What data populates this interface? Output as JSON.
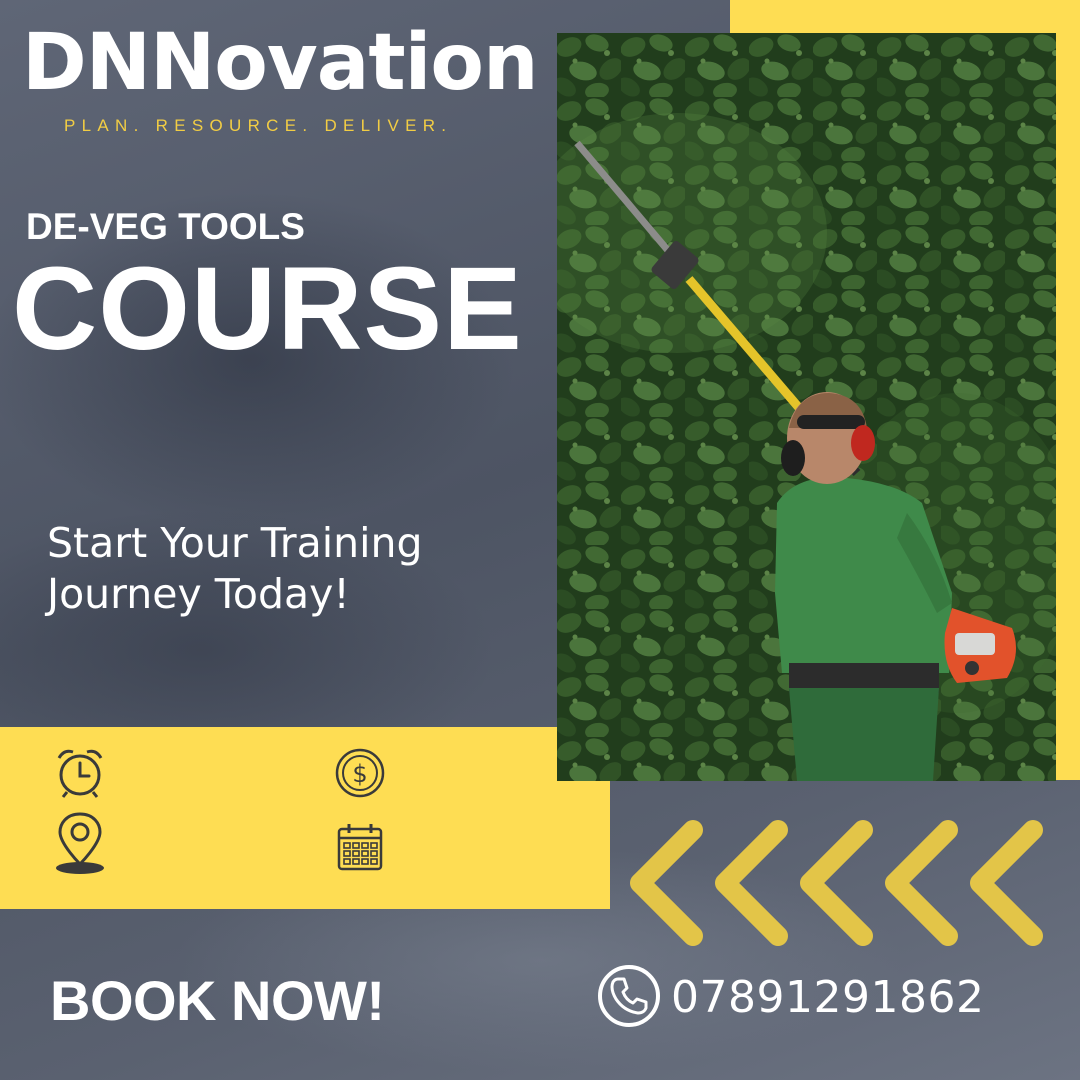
{
  "brand": {
    "name": "DNNovation",
    "tagline": "PLAN. RESOURCE. DELIVER."
  },
  "course": {
    "subtitle": "DE-VEG TOOLS",
    "title": "COURSE"
  },
  "promo": {
    "tagline_line1": "Start Your Training",
    "tagline_line2": "Journey Today!"
  },
  "info_icons": [
    "alarm-clock-icon",
    "dollar-coin-icon",
    "location-pin-icon",
    "calendar-icon"
  ],
  "cta": {
    "label": "BOOK NOW!",
    "phone": "07891291862",
    "phone_icon": "phone-icon"
  },
  "colors": {
    "accent_yellow": "#fedd53",
    "tagline_gold": "#f2cd44",
    "background_slate": "#545b6a",
    "chevron_gold": "#e3c548"
  }
}
